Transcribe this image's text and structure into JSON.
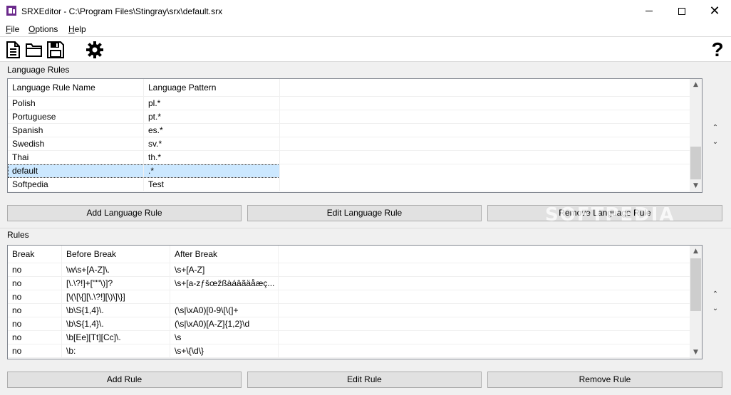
{
  "window": {
    "title": "SRXEditor - C:\\Program Files\\Stingray\\srx\\default.srx",
    "minimize_icon": "minimize-icon",
    "maximize_icon": "maximize-icon",
    "close_glyph": "✕"
  },
  "menu": {
    "file": {
      "mnemonic": "F",
      "rest": "ile"
    },
    "options": {
      "mnemonic": "O",
      "rest": "ptions"
    },
    "help": {
      "mnemonic": "H",
      "rest": "elp"
    }
  },
  "toolbar": {
    "icons": [
      "new-document-icon",
      "open-folder-icon",
      "save-disk-icon",
      "settings-gear-icon",
      "help-question-icon"
    ],
    "help_glyph": "?"
  },
  "language_rules": {
    "group_label": "Language Rules",
    "headers": [
      "Language Rule Name",
      "Language Pattern"
    ],
    "rows": [
      {
        "name": "Polish",
        "pattern": "pl.*"
      },
      {
        "name": "Portuguese",
        "pattern": "pt.*"
      },
      {
        "name": "Spanish",
        "pattern": "es.*"
      },
      {
        "name": "Swedish",
        "pattern": "sv.*"
      },
      {
        "name": "Thai",
        "pattern": "th.*"
      },
      {
        "name": "default",
        "pattern": ".*"
      },
      {
        "name": "Softpedia",
        "pattern": "Test"
      }
    ],
    "selected": "default",
    "buttons": {
      "add": "Add Language Rule",
      "edit": "Edit Language Rule",
      "remove": "Remove Language Rule"
    }
  },
  "rules": {
    "group_label": "Rules",
    "headers": [
      "Break",
      "Before Break",
      "After Break"
    ],
    "rows": [
      {
        "brk": "no",
        "before": "\\w\\s+[A-Z]\\.",
        "after": "\\s+[A-Z]"
      },
      {
        "brk": "no",
        "before": "[\\.\\?!]+[\"'\"\\)]?",
        "after": "\\s+[a-zƒšœžßàáâãäåæç..."
      },
      {
        "brk": "no",
        "before": "[\\(\\[\\{][\\.\\?!][\\)\\]\\}]",
        "after": ""
      },
      {
        "brk": "no",
        "before": "\\b\\S{1,4}\\.",
        "after": "(\\s|\\xA0)[0-9\\[\\(]+"
      },
      {
        "brk": "no",
        "before": "\\b\\S{1,4}\\.",
        "after": "(\\s|\\xA0)[A-Z]{1,2}\\d"
      },
      {
        "brk": "no",
        "before": "\\b[Ee][Tt][Cc]\\.",
        "after": "\\s"
      },
      {
        "brk": "no",
        "before": "\\b:",
        "after": "\\s+\\{\\d\\}"
      }
    ],
    "buttons": {
      "add": "Add Rule",
      "edit": "Edit Rule",
      "remove": "Remove Rule"
    }
  },
  "scroll": {
    "up": "▲",
    "down": "▼",
    "side_up": "⌃",
    "side_down": "⌄"
  },
  "watermark": "SOFTPEDIA",
  "colors": {
    "selection": "#cce8ff",
    "app_icon": "#6b2a8c"
  }
}
